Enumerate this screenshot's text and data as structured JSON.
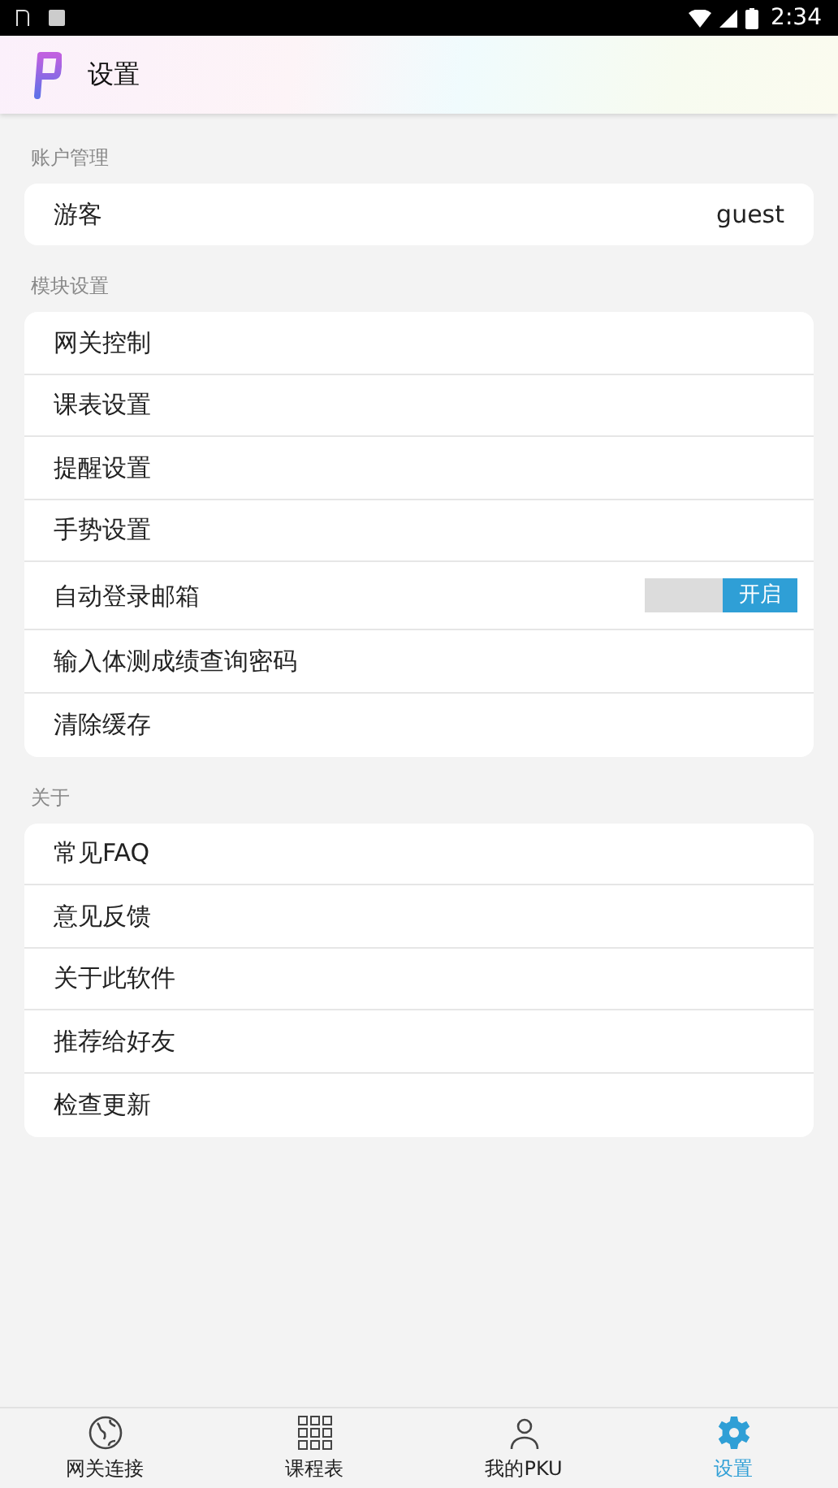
{
  "status_bar": {
    "time": "2:34"
  },
  "header": {
    "title": "设置"
  },
  "sections": [
    {
      "title": "账户管理",
      "items": [
        {
          "kind": "value",
          "label": "游客",
          "value": "guest"
        }
      ]
    },
    {
      "title": "模块设置",
      "items": [
        {
          "kind": "link",
          "label": "网关控制"
        },
        {
          "kind": "link",
          "label": "课表设置"
        },
        {
          "kind": "link",
          "label": "提醒设置"
        },
        {
          "kind": "link",
          "label": "手势设置"
        },
        {
          "kind": "toggle",
          "label": "自动登录邮箱",
          "on": true,
          "toggle_label": "开启"
        },
        {
          "kind": "link",
          "label": "输入体测成绩查询密码"
        },
        {
          "kind": "link",
          "label": "清除缓存"
        }
      ]
    },
    {
      "title": "关于",
      "items": [
        {
          "kind": "link",
          "label": "常见FAQ"
        },
        {
          "kind": "link",
          "label": "意见反馈"
        },
        {
          "kind": "link",
          "label": "关于此软件"
        },
        {
          "kind": "link",
          "label": "推荐给好友"
        },
        {
          "kind": "link",
          "label": "检查更新"
        }
      ]
    }
  ],
  "bottom_nav": [
    {
      "kind": "globe",
      "label": "网关连接",
      "selected": false
    },
    {
      "kind": "grid",
      "label": "课程表",
      "selected": false
    },
    {
      "kind": "person",
      "label": "我的PKU",
      "selected": false
    },
    {
      "kind": "gear",
      "label": "设置",
      "selected": true
    }
  ]
}
